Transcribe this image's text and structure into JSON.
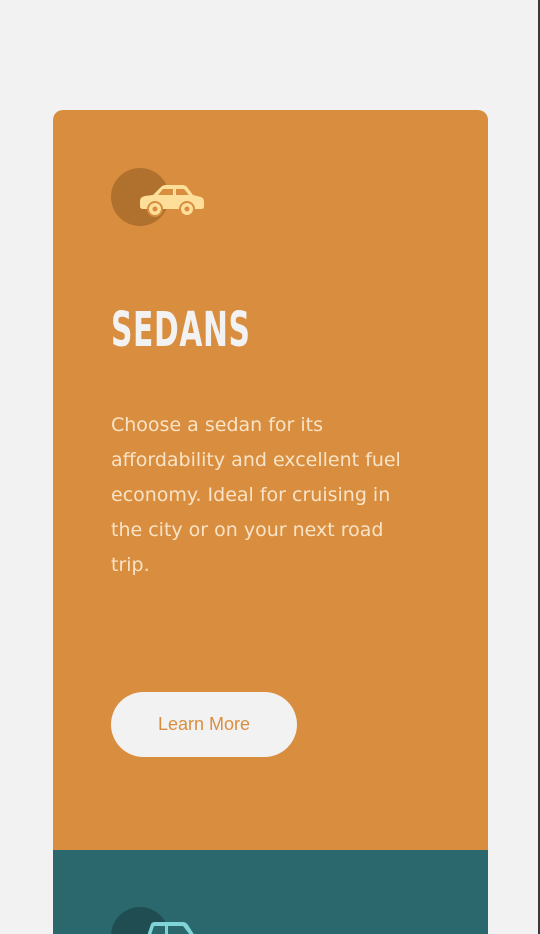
{
  "cards": [
    {
      "title": "SEDANS",
      "body": "Choose a sedan for its affordability and excellent fuel economy. Ideal for cruising in the city or on your next road trip.",
      "button_label": "Learn More",
      "icon": "sedan-car-icon",
      "colors": {
        "background": "#d98e3f",
        "icon": "#fddf9a",
        "button_text": "#d98e3f"
      }
    },
    {
      "icon": "suv-car-icon",
      "colors": {
        "background": "#2b686e",
        "icon": "#7fd4d7"
      }
    }
  ]
}
